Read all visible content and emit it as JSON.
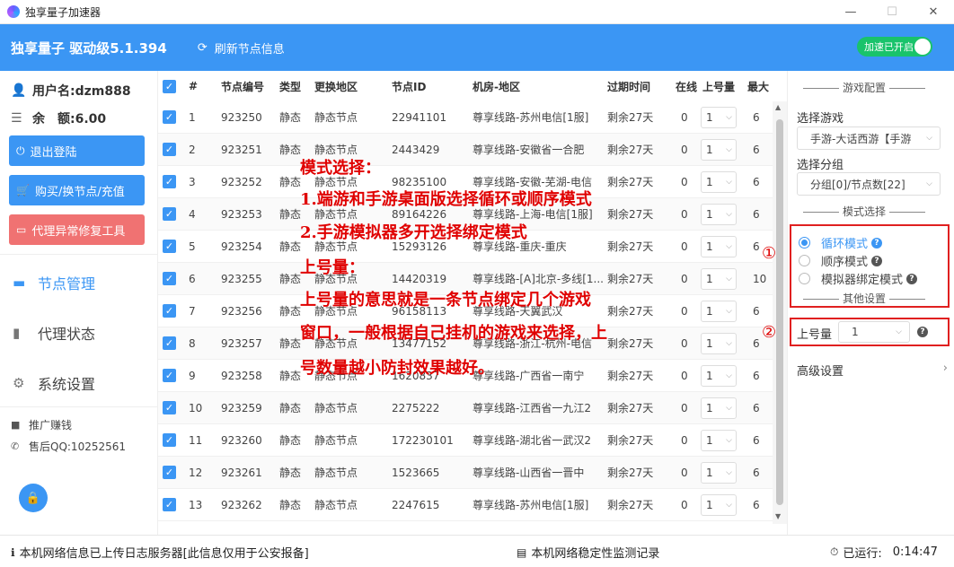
{
  "window": {
    "title": "独享量子加速器",
    "minimize": "—",
    "maximize": "☐",
    "close": "✕"
  },
  "header": {
    "brand": "独享量子 驱动级5.1.394",
    "refresh_label": "刷新节点信息",
    "accel_label": "加速已开启"
  },
  "sidebar": {
    "username": "用户名:dzm888",
    "balance": "余　额:6.00",
    "logout": "退出登陆",
    "buy": "购买/换节点/充值",
    "repair": "代理异常修复工具",
    "nav": [
      {
        "label": "节点管理"
      },
      {
        "label": "代理状态"
      },
      {
        "label": "系统设置"
      }
    ],
    "promote": "推广赚钱",
    "support": "售后QQ:10252561"
  },
  "table": {
    "headers": [
      "#",
      "节点编号",
      "类型",
      "更换地区",
      "节点ID",
      "机房-地区",
      "过期时间",
      "在线",
      "上号量",
      "最大"
    ],
    "rows": [
      {
        "n": "1",
        "id": "923250",
        "type": "静态",
        "region": "静态节点",
        "nid": "22941101",
        "room": "尊享线路-苏州电信[1服]",
        "exp": "剩余27天",
        "online": "0",
        "qty": "1",
        "max": "6"
      },
      {
        "n": "2",
        "id": "923251",
        "type": "静态",
        "region": "静态节点",
        "nid": "2443429",
        "room": "尊享线路-安徽省一合肥",
        "exp": "剩余27天",
        "online": "0",
        "qty": "1",
        "max": "6"
      },
      {
        "n": "3",
        "id": "923252",
        "type": "静态",
        "region": "静态节点",
        "nid": "98235100",
        "room": "尊享线路-安徽-芜湖-电信",
        "exp": "剩余27天",
        "online": "0",
        "qty": "1",
        "max": "6"
      },
      {
        "n": "4",
        "id": "923253",
        "type": "静态",
        "region": "静态节点",
        "nid": "89164226",
        "room": "尊享线路-上海-电信[1服]",
        "exp": "剩余27天",
        "online": "0",
        "qty": "1",
        "max": "6"
      },
      {
        "n": "5",
        "id": "923254",
        "type": "静态",
        "region": "静态节点",
        "nid": "15293126",
        "room": "尊享线路-重庆-重庆",
        "exp": "剩余27天",
        "online": "0",
        "qty": "1",
        "max": "6"
      },
      {
        "n": "6",
        "id": "923255",
        "type": "静态",
        "region": "静态节点",
        "nid": "14420319",
        "room": "尊享线路-[A]北京-多线[1...",
        "exp": "剩余27天",
        "online": "0",
        "qty": "1",
        "max": "10"
      },
      {
        "n": "7",
        "id": "923256",
        "type": "静态",
        "region": "静态节点",
        "nid": "96158113",
        "room": "尊享线路-天翼武汉",
        "exp": "剩余27天",
        "online": "0",
        "qty": "1",
        "max": "6"
      },
      {
        "n": "8",
        "id": "923257",
        "type": "静态",
        "region": "静态节点",
        "nid": "13477152",
        "room": "尊享线路-浙江-杭州-电信",
        "exp": "剩余27天",
        "online": "0",
        "qty": "1",
        "max": "6"
      },
      {
        "n": "9",
        "id": "923258",
        "type": "静态",
        "region": "静态节点",
        "nid": "1620837",
        "room": "尊享线路-广西省一南宁",
        "exp": "剩余27天",
        "online": "0",
        "qty": "1",
        "max": "6"
      },
      {
        "n": "10",
        "id": "923259",
        "type": "静态",
        "region": "静态节点",
        "nid": "2275222",
        "room": "尊享线路-江西省一九江2",
        "exp": "剩余27天",
        "online": "0",
        "qty": "1",
        "max": "6"
      },
      {
        "n": "11",
        "id": "923260",
        "type": "静态",
        "region": "静态节点",
        "nid": "172230101",
        "room": "尊享线路-湖北省一武汉2",
        "exp": "剩余27天",
        "online": "0",
        "qty": "1",
        "max": "6"
      },
      {
        "n": "12",
        "id": "923261",
        "type": "静态",
        "region": "静态节点",
        "nid": "1523665",
        "room": "尊享线路-山西省一晋中",
        "exp": "剩余27天",
        "online": "0",
        "qty": "1",
        "max": "6"
      },
      {
        "n": "13",
        "id": "923262",
        "type": "静态",
        "region": "静态节点",
        "nid": "2247615",
        "room": "尊享线路-苏州电信[1服]",
        "exp": "剩余27天",
        "online": "0",
        "qty": "1",
        "max": "6"
      }
    ]
  },
  "overlay": {
    "lines": [
      "模式选择：",
      "1.端游和手游桌面版选择循环或顺序模式",
      "2.手游模拟器多开选择绑定模式",
      "上号量：",
      "上号量的意思就是一条节点绑定几个游戏",
      "窗口，一般根据自己挂机的游戏来选择，上",
      "号数量越小防封效果越好。"
    ]
  },
  "right": {
    "game_config": "游戏配置",
    "choose_game": "选择游戏",
    "game_value": "手游-大话西游【手游",
    "choose_group": "选择分组",
    "group_value": "分组[0]/节点数[22]",
    "mode_title": "模式选择",
    "modes": [
      "循环模式",
      "顺序模式",
      "模拟器绑定模式"
    ],
    "other_title": "其他设置",
    "qty_label": "上号量",
    "qty_value": "1",
    "advanced": "高级设置",
    "mark1": "①",
    "mark2": "②"
  },
  "status": {
    "left": "本机网络信息已上传日志服务器[此信息仅用于公安报备]",
    "middle": "本机网络稳定性监测记录",
    "runtime_label": "已运行:",
    "runtime_value": "0:14:47"
  },
  "colors": {
    "primary": "#3b96f4",
    "danger": "#f07272",
    "success": "#19c36b",
    "annotation": "#e00000"
  }
}
